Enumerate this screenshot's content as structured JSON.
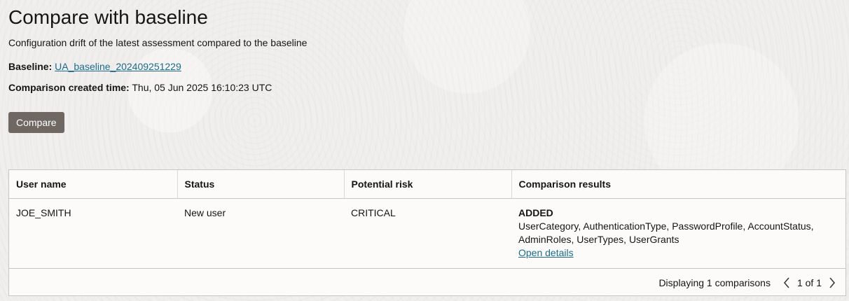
{
  "page": {
    "title": "Compare with baseline",
    "subtitle": "Configuration drift of the latest assessment compared to the baseline"
  },
  "baseline": {
    "label": "Baseline:",
    "value": "UA_baseline_202409251229"
  },
  "comparison_time": {
    "label": "Comparison created time:",
    "value": "Thu, 05 Jun 2025 16:10:23 UTC"
  },
  "compare_button": {
    "label": "Compare"
  },
  "table": {
    "columns": [
      "User name",
      "Status",
      "Potential risk",
      "Comparison results"
    ],
    "rows": [
      {
        "user_name": "JOE_SMITH",
        "status": "New user",
        "potential_risk": "CRITICAL",
        "result_label": "ADDED",
        "result_text": "UserCategory, AuthenticationType, PasswordProfile, AccountStatus, AdminRoles, UserTypes, UserGrants",
        "details_link": "Open details"
      }
    ]
  },
  "footer": {
    "summary": "Displaying 1 comparisons",
    "page_indicator": "1 of 1"
  },
  "icons": {
    "prev": "chevron-left-icon",
    "next": "chevron-right-icon"
  },
  "colors": {
    "link": "#1b6b8c",
    "button": "#6f6862",
    "background": "#f1efed"
  }
}
